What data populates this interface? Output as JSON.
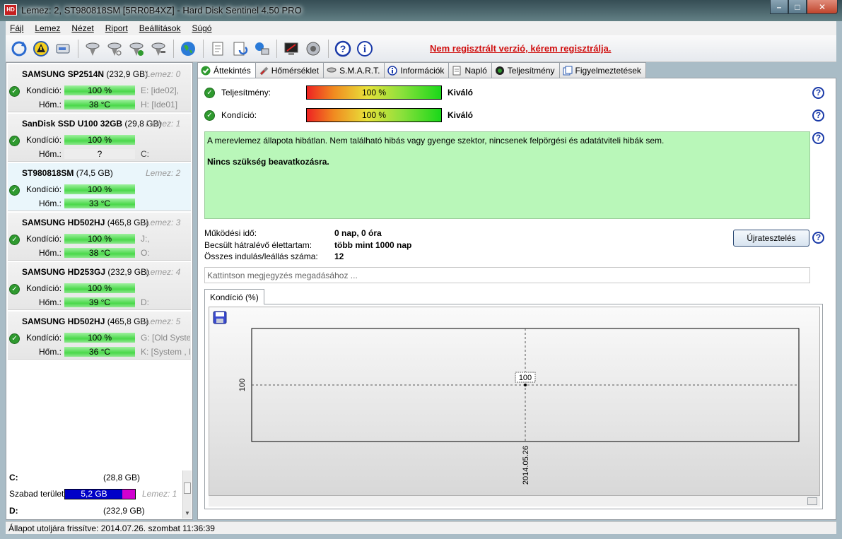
{
  "window": {
    "title": "Lemez: 2, ST980818SM [5RR0B4XZ]  -  Hard Disk Sentinel 4.50 PRO"
  },
  "menu": [
    "Fájl",
    "Lemez",
    "Nézet",
    "Riport",
    "Beállítások",
    "Súgó"
  ],
  "toolbar": {
    "registration_warning": "Nem regisztrált verzió, kérem regisztrálja."
  },
  "disks": [
    {
      "name": "SAMSUNG SP2514N",
      "capacity": "(232,9 GB)",
      "lemez": "Lemez: 0",
      "condition_label": "Kondíció:",
      "condition": "100 %",
      "temp_label": "Hőm.:",
      "temp": "38 °C",
      "drive1": "E: [ide02],",
      "drive2": "H: [Ide01]"
    },
    {
      "name": "SanDisk SSD U100 32GB",
      "capacity": "(29,8 GB)",
      "lemez": "Lemez: 1",
      "condition_label": "Kondíció:",
      "condition": "100 %",
      "temp_label": "Hőm.:",
      "temp": "?",
      "drive1": "",
      "drive2": "C:"
    },
    {
      "name": "ST980818SM",
      "capacity": "(74,5 GB)",
      "lemez": "Lemez: 2",
      "condition_label": "Kondíció:",
      "condition": "100 %",
      "temp_label": "Hőm.:",
      "temp": "33 °C",
      "drive1": "",
      "drive2": ""
    },
    {
      "name": "SAMSUNG HD502HJ",
      "capacity": "(465,8 GB)",
      "lemez": "Lemez: 3",
      "condition_label": "Kondíció:",
      "condition": "100 %",
      "temp_label": "Hőm.:",
      "temp": "38 °C",
      "drive1": "J:,",
      "drive2": "O:"
    },
    {
      "name": "SAMSUNG HD253GJ",
      "capacity": "(232,9 GB)",
      "lemez": "Lemez: 4",
      "condition_label": "Kondíció:",
      "condition": "100 %",
      "temp_label": "Hőm.:",
      "temp": "39 °C",
      "drive1": "",
      "drive2": "D:"
    },
    {
      "name": "SAMSUNG HD502HJ",
      "capacity": "(465,8 GB)",
      "lemez": "Lemez: 5",
      "condition_label": "Kondíció:",
      "condition": "100 %",
      "temp_label": "Hőm.:",
      "temp": "36 °C",
      "drive1": "G: [Old System]",
      "drive2": "K: [System , P"
    }
  ],
  "partitions": {
    "c_label": "C:",
    "c_size": "(28,8 GB)",
    "free_label": "Szabad terület",
    "free_value": "5,2 GB",
    "free_fraction": 0.18,
    "free_lemez": "Lemez: 1",
    "d_label": "D:",
    "d_size": "(232,9 GB)"
  },
  "tabs": [
    "Áttekintés",
    "Hőmérséklet",
    "S.M.A.R.T.",
    "Információk",
    "Napló",
    "Teljesítmény",
    "Figyelmeztetések"
  ],
  "overview": {
    "performance_label": "Teljesítmény:",
    "performance_value": "100 %",
    "performance_rating": "Kiváló",
    "condition_label": "Kondíció:",
    "condition_value": "100 %",
    "condition_rating": "Kiváló",
    "status_text": "A merevlemez állapota hibátlan. Nem található hibás vagy gyenge szektor, nincsenek felpörgési és adatátviteli hibák sem.",
    "status_action": "Nincs szükség beavatkozásra.",
    "uptime_label": "Működési idő:",
    "uptime_value": "0 nap, 0 óra",
    "lifetime_label": "Becsült hátralévő élettartam:",
    "lifetime_value": "több mint 1000 nap",
    "startstop_label": "Összes indulás/leállás száma:",
    "startstop_value": "12",
    "retest_button": "Újratesztelés",
    "comment_placeholder": "Kattintson megjegyzés megadásához ..."
  },
  "graph_tab": "Kondíció  (%)",
  "chart_data": {
    "type": "line",
    "x": [
      "2014.05.26"
    ],
    "series": [
      {
        "values": [
          100
        ]
      }
    ],
    "data_labels": [
      "100"
    ],
    "ytick": "100",
    "grid": true
  },
  "statusbar": {
    "text": "Állapot utoljára frissítve: 2014.07.26. szombat 11:36:39"
  },
  "colors": {
    "status_ok_bg": "#b9f7b9",
    "warning_red": "#d01010",
    "free_bar": "#0000c8",
    "free_bar_accent": "#d000d0"
  }
}
